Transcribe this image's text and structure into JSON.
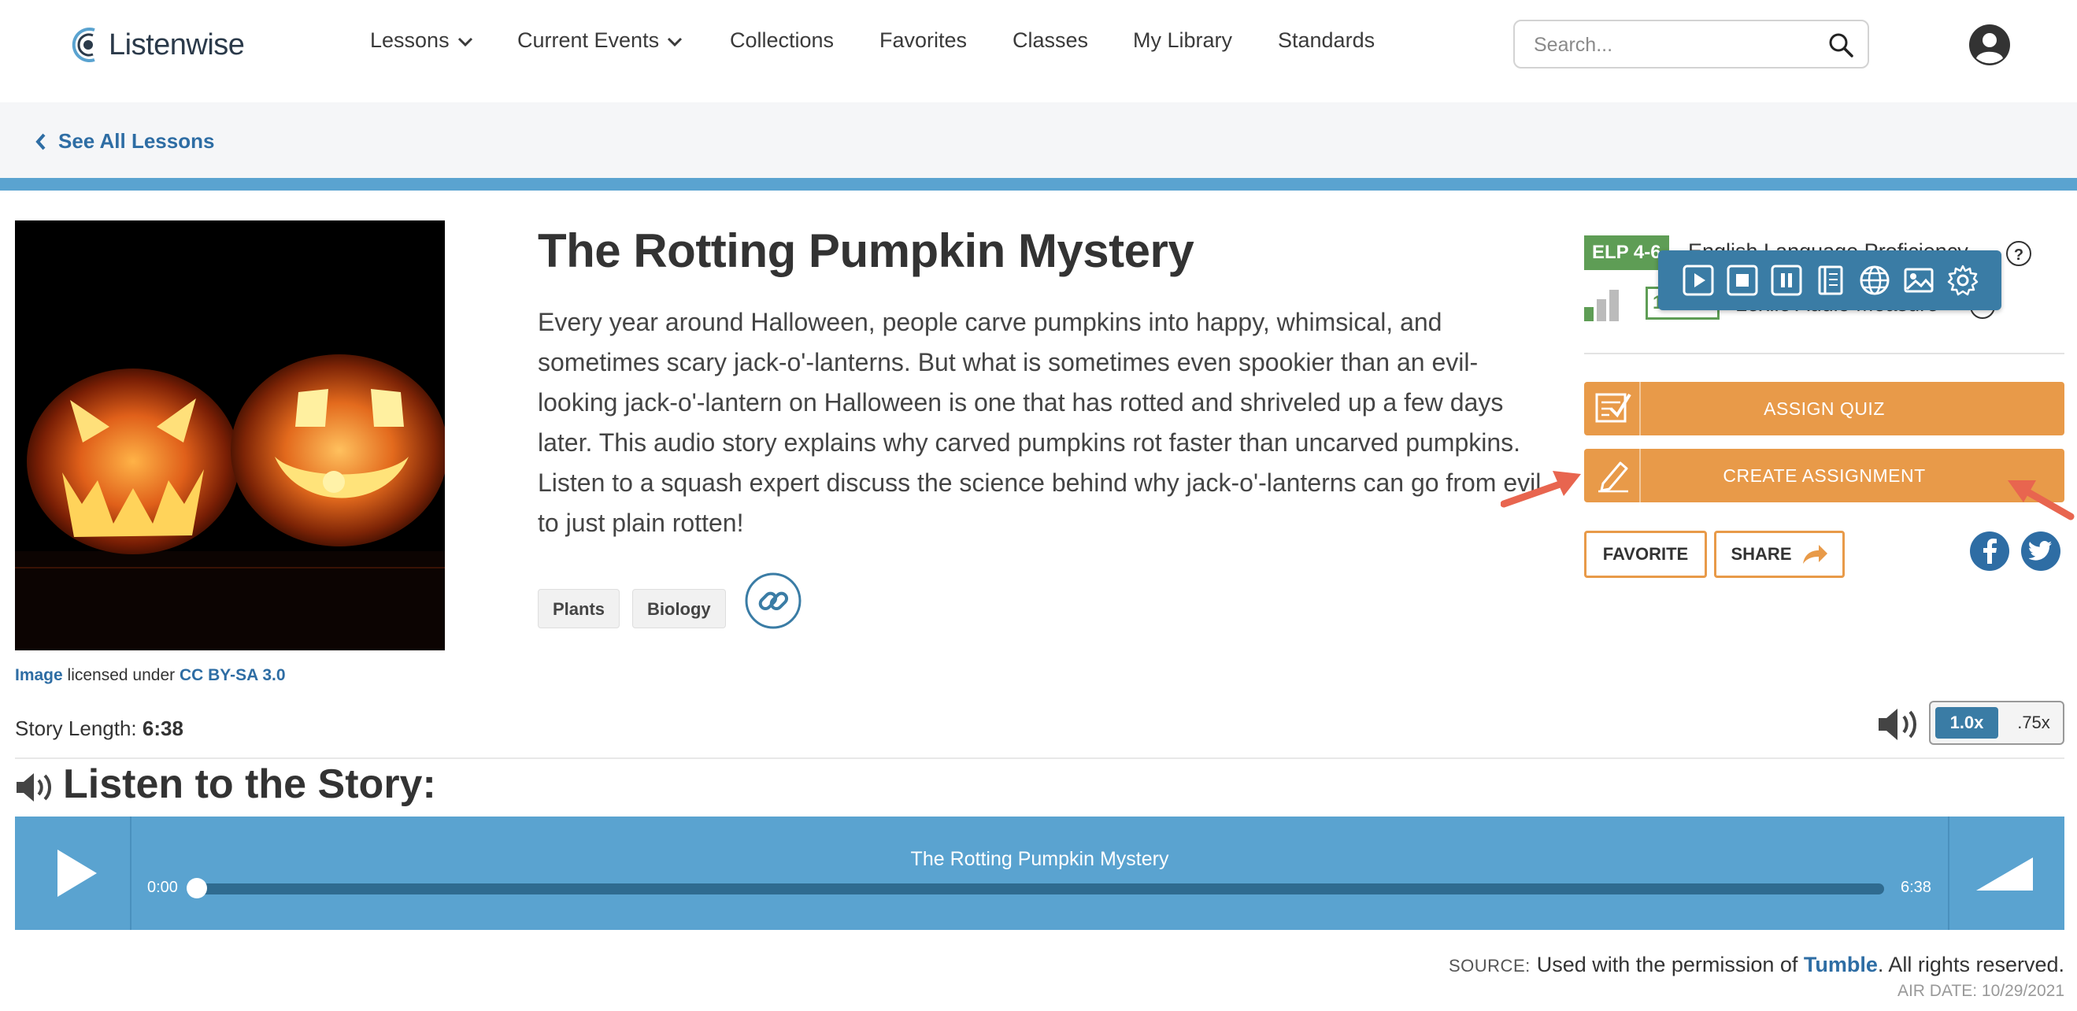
{
  "brand": {
    "name": "Listenwise"
  },
  "nav": [
    {
      "label": "Lessons",
      "dropdown": true
    },
    {
      "label": "Current Events",
      "dropdown": true
    },
    {
      "label": "Collections",
      "dropdown": false
    },
    {
      "label": "Favorites",
      "dropdown": false
    },
    {
      "label": "Classes",
      "dropdown": false
    },
    {
      "label": "My Library",
      "dropdown": false
    },
    {
      "label": "Standards",
      "dropdown": false
    }
  ],
  "search": {
    "placeholder": "Search...",
    "value": ""
  },
  "breadcrumb": {
    "label": "See All Lessons"
  },
  "lesson": {
    "title": "The Rotting Pumpkin Mystery",
    "description": "Every year around Halloween, people carve pumpkins into happy, whimsical, and sometimes scary jack-o'-lanterns. But what is sometimes even spookier than an evil-looking jack-o'-lantern on Halloween is one that has rotted and shriveled up a few days later. This audio story explains why carved pumpkins rot faster than uncarved pumpkins. Listen to a squash expert discuss the science behind why jack-o'-lanterns can go from evil to just plain rotten!",
    "tags": [
      "Plants",
      "Biology"
    ],
    "license": {
      "image_link": "Image",
      "middle": " licensed under ",
      "license_link": "CC BY-SA 3.0"
    }
  },
  "levels": {
    "elp_badge": "ELP 4-6",
    "elp_label": "English Language Proficiency",
    "help": "?",
    "lexile_value": "1",
    "lexile_label": "Lexile Audio Measure"
  },
  "actions": {
    "assign_quiz": "ASSIGN QUIZ",
    "create_assignment": "CREATE ASSIGNMENT",
    "favorite": "FAVORITE",
    "share": "SHARE"
  },
  "story": {
    "length_label": "Story Length: ",
    "length_value": "6:38",
    "listen_heading": "Listen to the Story:",
    "speed_options": [
      "1.0x",
      ".75x"
    ],
    "speed_selected": "1.0x"
  },
  "player": {
    "title": "The Rotting Pumpkin Mystery",
    "current": "0:00",
    "duration": "6:38",
    "progress": 0
  },
  "source": {
    "label": "SOURCE:",
    "prefix": "Used with the permission of ",
    "link": "Tumble",
    "suffix": ". All rights reserved.",
    "air_date": "AIR DATE: 10/29/2021"
  },
  "colors": {
    "accent_blue": "#5aa3d0",
    "link_blue": "#2e6da4",
    "orange": "#e89a49",
    "elp_green": "#5e9d55",
    "annotation_red": "#e8654f"
  }
}
